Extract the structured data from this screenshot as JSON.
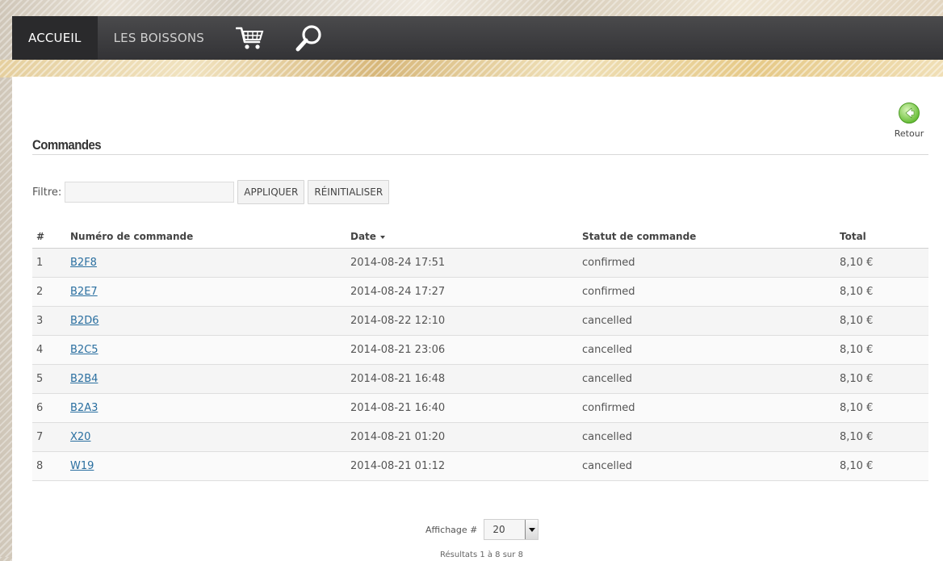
{
  "nav": {
    "items": [
      {
        "label": "ACCUEIL",
        "active": true
      },
      {
        "label": "LES BOISSONS",
        "active": false
      }
    ],
    "icons": [
      "cart-icon",
      "search-icon"
    ]
  },
  "back": {
    "label": "Retour",
    "icon": "back-arrow-icon",
    "color": "#5cb82a"
  },
  "page": {
    "title": "Commandes"
  },
  "filter": {
    "label": "Filtre:",
    "value": "",
    "apply_label": "APPLIQUER",
    "reset_label": "RÉINITIALISER"
  },
  "table": {
    "headers": {
      "index": "#",
      "number": "Numéro de commande",
      "date": "Date",
      "status": "Statut de commande",
      "total": "Total"
    },
    "sort": {
      "column": "date",
      "direction": "desc"
    },
    "rows": [
      {
        "index": "1",
        "number": "B2F8",
        "date": "2014-08-24 17:51",
        "status": "confirmed",
        "total": "8,10 €"
      },
      {
        "index": "2",
        "number": "B2E7",
        "date": "2014-08-24 17:27",
        "status": "confirmed",
        "total": "8,10 €"
      },
      {
        "index": "3",
        "number": "B2D6",
        "date": "2014-08-22 12:10",
        "status": "cancelled",
        "total": "8,10 €"
      },
      {
        "index": "4",
        "number": "B2C5",
        "date": "2014-08-21 23:06",
        "status": "cancelled",
        "total": "8,10 €"
      },
      {
        "index": "5",
        "number": "B2B4",
        "date": "2014-08-21 16:48",
        "status": "cancelled",
        "total": "8,10 €"
      },
      {
        "index": "6",
        "number": "B2A3",
        "date": "2014-08-21 16:40",
        "status": "confirmed",
        "total": "8,10 €"
      },
      {
        "index": "7",
        "number": "X20",
        "date": "2014-08-21 01:20",
        "status": "cancelled",
        "total": "8,10 €"
      },
      {
        "index": "8",
        "number": "W19",
        "date": "2014-08-21 01:12",
        "status": "cancelled",
        "total": "8,10 €"
      }
    ]
  },
  "pager": {
    "label": "Affichage #",
    "selected": "20",
    "results": "Résultats 1 à 8 sur 8"
  },
  "colors": {
    "link": "#2a6fa0",
    "nav_bg": "#3d3d40",
    "nav_active": "#2a2a2c"
  }
}
